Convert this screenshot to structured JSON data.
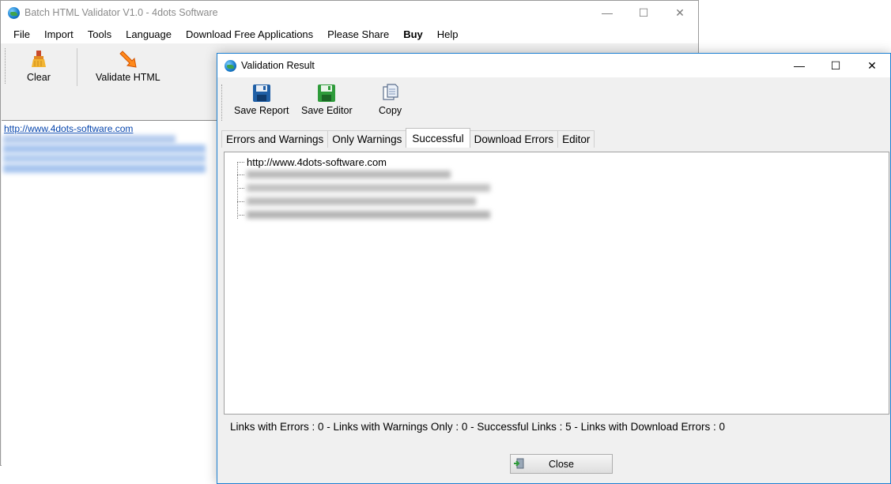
{
  "main_window": {
    "title": "Batch HTML Validator V1.0 - 4dots Software",
    "menu": [
      "File",
      "Import",
      "Tools",
      "Language",
      "Download Free Applications",
      "Please Share",
      "Buy",
      "Help"
    ],
    "toolbar": {
      "clear_label": "Clear",
      "validate_label": "Validate HTML"
    },
    "url_list": {
      "first_url": "http://www.4dots-software.com"
    }
  },
  "dialog": {
    "title": "Validation Result",
    "toolbar": {
      "save_report": "Save Report",
      "save_editor": "Save Editor",
      "copy": "Copy"
    },
    "tabs": [
      "Errors and Warnings",
      "Only Warnings",
      "Successful",
      "Download Errors",
      "Editor"
    ],
    "active_tab": "Successful",
    "tree_items": [
      "http://www.4dots-software.com"
    ],
    "summary": "Links with Errors : 0 - Links with Warnings Only : 0 - Successful Links : 5 - Links with Download Errors : 0",
    "close_label": "Close"
  },
  "window_controls": {
    "minimize": "—",
    "maximize": "☐",
    "close": "✕"
  },
  "colors": {
    "accent": "#1b7fd1",
    "link": "#0645ad"
  }
}
